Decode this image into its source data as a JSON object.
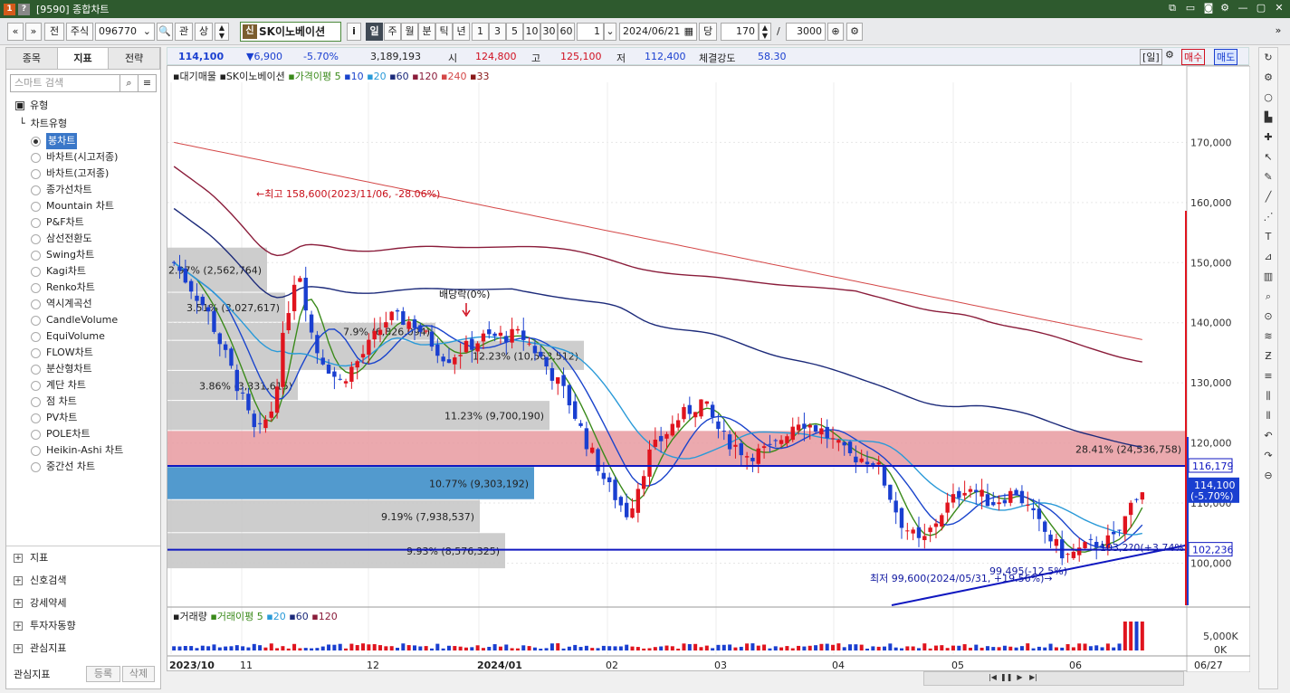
{
  "window": {
    "title": "[9590] 종합차트",
    "icon_a": "1",
    "icon_b": "?"
  },
  "toolbar": {
    "nav_prev": "«",
    "nav_down": "»",
    "jeon": "전",
    "market": "주식",
    "code": "096770",
    "search_icon": "🔍",
    "gwan": "관",
    "sang": "상",
    "stock_badge": "신",
    "stock_name": "SK이노베이션",
    "info": "i",
    "periods": [
      "일",
      "주",
      "월",
      "분",
      "틱",
      "년"
    ],
    "active_period": "일",
    "intervals": [
      "1",
      "3",
      "5",
      "10",
      "30",
      "60"
    ],
    "count": "1",
    "date": "2024/06/21",
    "dang": "당",
    "view_count": "170",
    "slash": "/",
    "total_count": "3000"
  },
  "left_panel": {
    "tabs": [
      "종목",
      "지표",
      "전략"
    ],
    "active_tab": "지표",
    "search_placeholder": "스마트 검색",
    "group_label": "유형",
    "subgroup_label": "차트유형",
    "chart_types": [
      "봉차트",
      "바차트(시고저종)",
      "바차트(고저종)",
      "종가선차트",
      "Mountain 차트",
      "P&F차트",
      "삼선전환도",
      "Swing차트",
      "Kagi차트",
      "Renko차트",
      "역시계곡선",
      "CandleVolume",
      "EquiVolume",
      "FLOW차트",
      "분산형차트",
      "계단 차트",
      "점 차트",
      "PV차트",
      "POLE차트",
      "Heikin-Ashi 차트",
      "중간선 차트"
    ],
    "selected_type": "봉차트",
    "bottom_groups": [
      "지표",
      "신호검색",
      "강세약세",
      "투자자동향",
      "관심지표"
    ],
    "fav_label": "관심지표",
    "fav_register": "등록",
    "fav_delete": "삭제"
  },
  "quote": {
    "price": "114,100",
    "change": "▼6,900",
    "rate": "-5.70%",
    "volume": "3,189,193",
    "open_label": "시",
    "open": "124,800",
    "high_label": "고",
    "high": "125,100",
    "low_label": "저",
    "low": "112,400",
    "strength_label": "체결강도",
    "strength": "58.30",
    "il": "[일]",
    "buy": "매수",
    "sell": "매도"
  },
  "legend": {
    "title": "대기매물",
    "name": "SK이노베이션",
    "ma_label": "가격이평",
    "ma_periods": [
      "5",
      "10",
      "20",
      "60",
      "120",
      "240",
      "33"
    ],
    "ma_colors": [
      "#3a8a1a",
      "#1a44cc",
      "#1a44cc",
      "#1a2f8a",
      "#8a1a3a",
      "#d04040",
      "#8a1a1a"
    ]
  },
  "volume_legend": {
    "title": "거래량",
    "ma_label": "거래이평",
    "periods": [
      "5",
      "20",
      "60",
      "120"
    ]
  },
  "colors": {
    "up": "#e0141e",
    "down": "#1a3fd0",
    "ma5": "#3a8a1a",
    "ma10": "#1a44cc",
    "ma20": "#2a9ad8",
    "ma60": "#1c2a7a",
    "ma120": "#8a1c3a",
    "ma240": "#d44848"
  },
  "chart_data": {
    "type": "candlestick",
    "yticks": [
      100000,
      110000,
      120000,
      130000,
      140000,
      150000,
      160000,
      170000
    ],
    "ylim": [
      93000,
      180000
    ],
    "ytick_labels": [
      "100,000",
      "110,000",
      "120,000",
      "130,000",
      "140,000",
      "150,000",
      "160,000",
      "170,000"
    ],
    "x_labels": [
      "2023/10",
      "11",
      "12",
      "2024/01",
      "02",
      "03",
      "04",
      "05",
      "06"
    ],
    "right_label": "06/27",
    "annotations": {
      "high": "←최고 158,600(2023/11/06, -28.06%)",
      "low": "최저 99,600(2024/05/31, +19.56%)→",
      "dividend": "배당락(0%)",
      "low_range": "99,495(-12.5%)",
      "last_pct": "103,2?0(+3.74%)"
    },
    "price_tags": {
      "current": "114,100",
      "current_rate": "(-5.70%)",
      "level_upper": "116,179",
      "level_lower": "102,236"
    },
    "volume_profile": [
      {
        "label": "2.97% (2,562,764)",
        "price_lo": 145000,
        "price_hi": 152500
      },
      {
        "label": "3.51% (3,027,617)",
        "price_lo": 140000,
        "price_hi": 145000
      },
      {
        "label": "7.9% (6,826,094)",
        "price_lo": 137000,
        "price_hi": 140000
      },
      {
        "label": "12.23% (10,563,512)",
        "price_lo": 132000,
        "price_hi": 137000
      },
      {
        "label": "3.86% (3,331,615)",
        "price_lo": 127000,
        "price_hi": 132000
      },
      {
        "label": "11.23% (9,700,190)",
        "price_lo": 122000,
        "price_hi": 127000
      },
      {
        "label": "28.41% (24,536,758)",
        "price_lo": 116000,
        "price_hi": 122000
      },
      {
        "label": "10.77% (9,303,192)",
        "price_lo": 110500,
        "price_hi": 116000
      },
      {
        "label": "9.19% (7,938,537)",
        "price_lo": 105000,
        "price_hi": 110500
      },
      {
        "label": "9.93% (8,576,325)",
        "price_lo": 99000,
        "price_hi": 105000
      }
    ],
    "volume_ticks": [
      "5,000K",
      "0K"
    ]
  }
}
